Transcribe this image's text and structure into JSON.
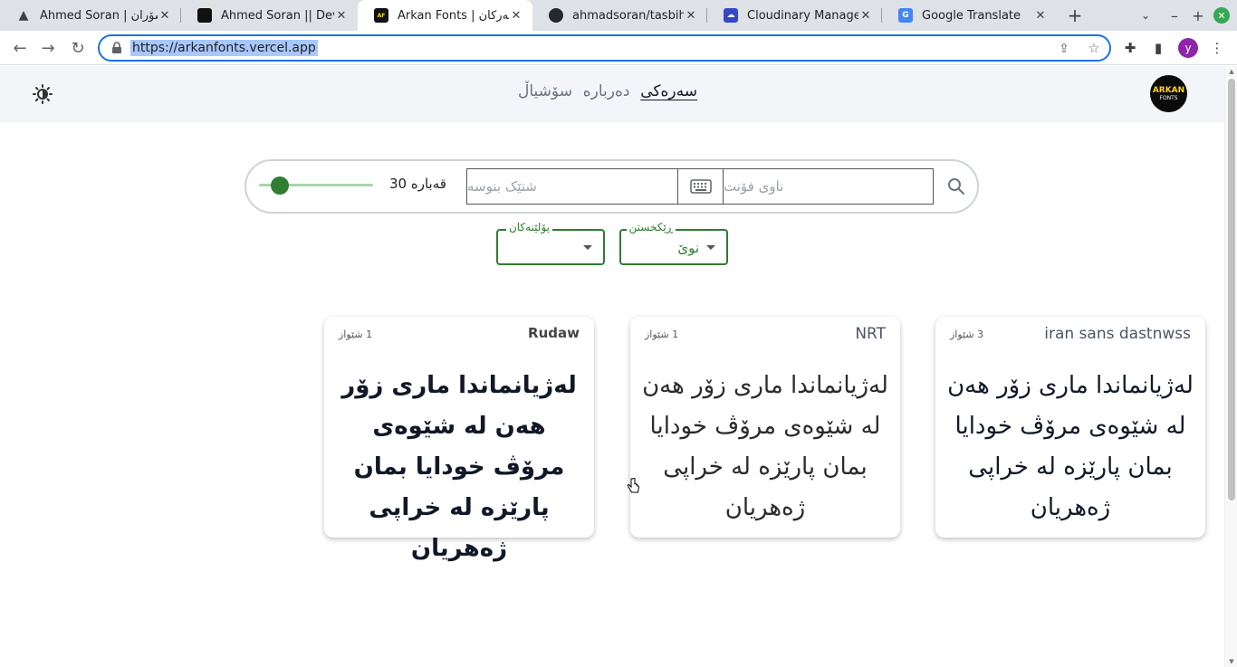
{
  "browser": {
    "tabs": [
      {
        "title": "Ahmed Soran | سۆران",
        "favicon_color": "#3c4043",
        "favicon_char": "▲"
      },
      {
        "title": "Ahmed Soran || Dev",
        "favicon_color": "#111111",
        "favicon_char": "▣"
      },
      {
        "title": "Arkan Fonts | فۆنتی ئەرکان",
        "favicon_color": "#111111",
        "favicon_char": "AF"
      },
      {
        "title": "ahmadsoran/tasbihat",
        "favicon_color": "#24292f",
        "favicon_char": "●"
      },
      {
        "title": "Cloudinary Management",
        "favicon_color": "#3448c5",
        "favicon_char": "☁"
      },
      {
        "title": "Google Translate",
        "favicon_color": "#4285f4",
        "favicon_char": "G"
      }
    ],
    "url": "https://arkanfonts.vercel.app",
    "profile_initial": "y"
  },
  "header": {
    "nav": [
      "سەرەکی",
      "دەربارە",
      "سۆشیاڵ"
    ],
    "logo_top": "ARKAN",
    "logo_bottom": "FONTS"
  },
  "search": {
    "font_name_placeholder": "ناوی فۆنت",
    "text_placeholder": "شتێک بنوسە",
    "size_label": "قەبارە",
    "size_value": "30",
    "size_level_fraction": 0.12
  },
  "filters": {
    "sort": {
      "label": "ڕێکخستن",
      "value": "نوێ"
    },
    "category": {
      "label": "پۆلێنەکان",
      "value": ""
    }
  },
  "cards": [
    {
      "font_name": "iran sans dastnwss",
      "style_count": "3 شێواز",
      "sample": "لەژیانماندا ماری زۆر هەن لە شێوەی مرۆڤ خودایا بمان پارێزە لە خراپی ژەهریان"
    },
    {
      "font_name": "NRT",
      "style_count": "1 شێواز",
      "sample": "لەژیانماندا ماری زۆر هەن لە شێوەی مرۆڤ خودایا بمان پارێزە لە خراپی ژەهریان"
    },
    {
      "font_name": "Rudaw",
      "style_count": "1 شێواز",
      "sample": "لەژیانماندا ماری زۆر هەن لە شێوەی مرۆڤ خودایا بمان پارێزە لە خراپی ژەهریان"
    }
  ],
  "colors": {
    "accent": "#2e7d32",
    "header_bg": "#f3f5f8",
    "omnibox_border": "#1a73e8"
  }
}
